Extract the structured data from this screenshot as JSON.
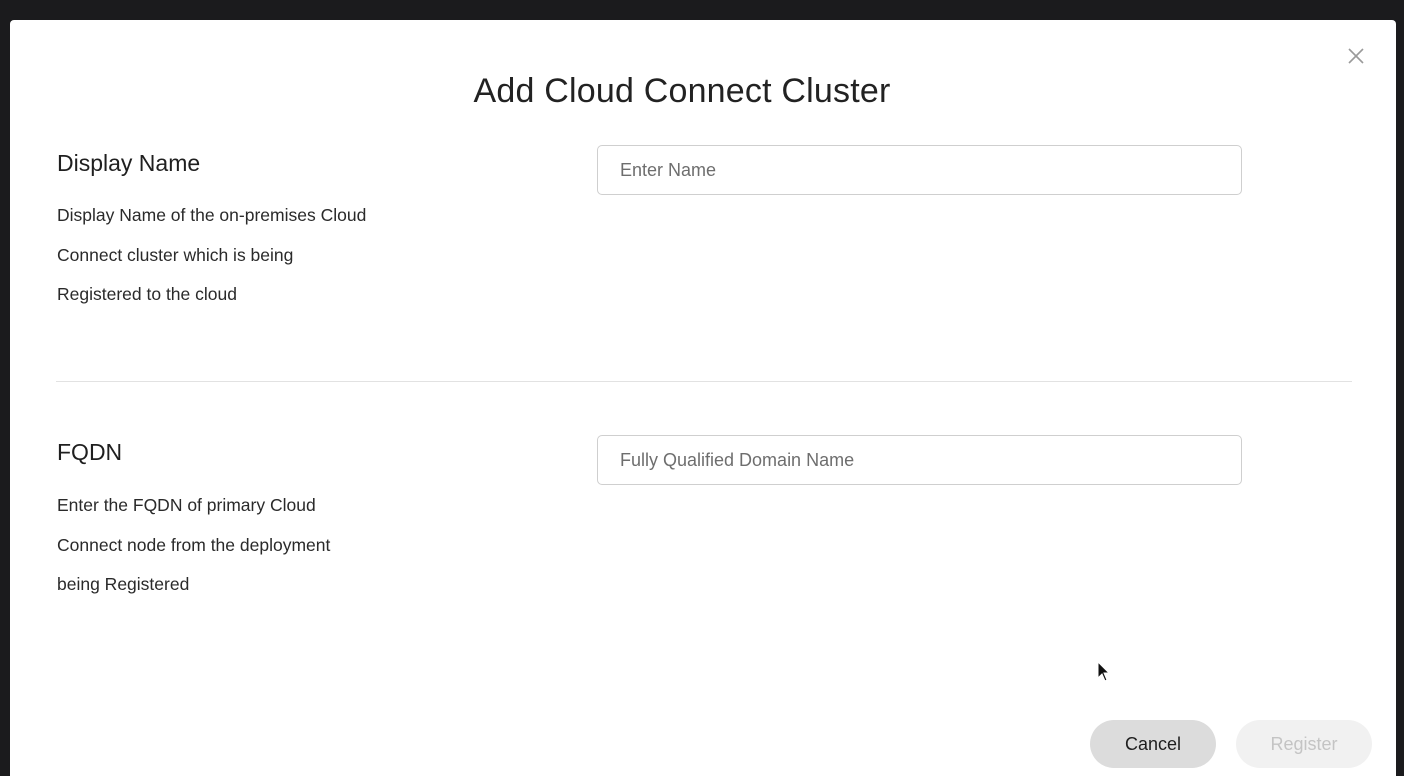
{
  "dialog": {
    "title": "Add Cloud Connect Cluster",
    "close_icon": "close-icon"
  },
  "display_name_section": {
    "heading": "Display Name",
    "description_lines": [
      "Display Name of the on-premises Cloud",
      "Connect cluster which is being",
      "Registered to the cloud"
    ],
    "input_placeholder": "Enter Name",
    "input_value": ""
  },
  "fqdn_section": {
    "heading": "FQDN",
    "description_lines": [
      "Enter the FQDN of primary Cloud",
      "Connect node from the deployment",
      "being Registered"
    ],
    "input_placeholder": "Fully Qualified Domain Name",
    "input_value": ""
  },
  "footer": {
    "cancel_label": "Cancel",
    "register_label": "Register",
    "register_enabled": false
  },
  "colors": {
    "backdrop": "#1b1b1d",
    "dialog_background": "#ffffff",
    "cancel_button_bg": "#dcdcdc",
    "register_button_disabled_bg": "#f1f1f1",
    "register_button_disabled_text": "#c4c4c4"
  }
}
